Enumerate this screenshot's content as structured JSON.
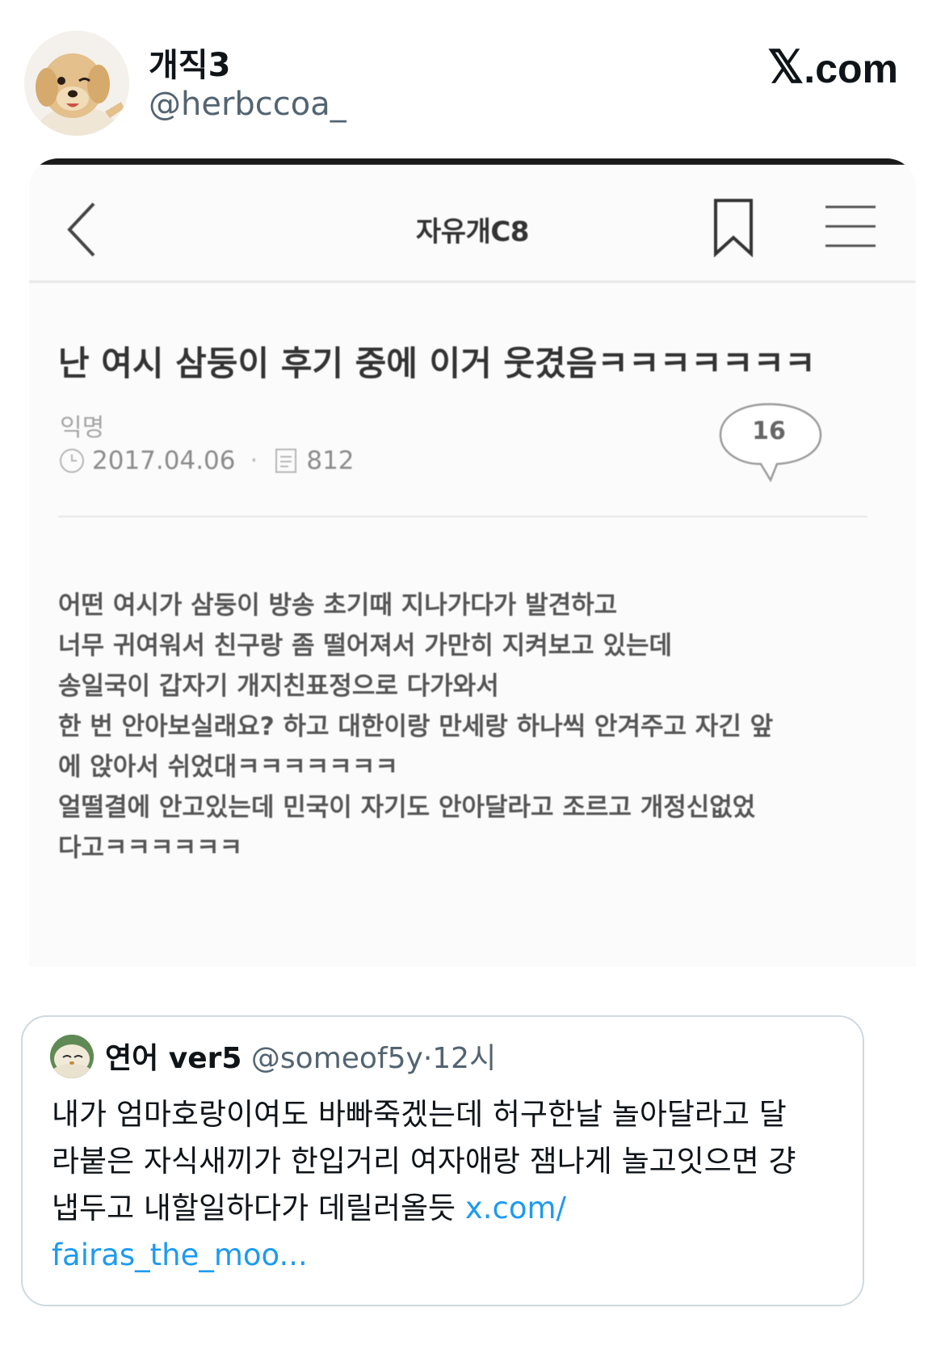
{
  "author": {
    "display_name": "개직3",
    "handle": "@herbccoa_"
  },
  "watermark": {
    "logo": "𝕏",
    "suffix": ".com"
  },
  "screenshot": {
    "board_title": "자유개C8",
    "post_title": "난 여시 삼둥이 후기 중에 이거 웃겼음ㅋㅋㅋㅋㅋㅋㅋ",
    "author": "익명",
    "date": "2017.04.06",
    "views": "812",
    "comment_count": "16",
    "body_lines": [
      "어떤 여시가 삼둥이 방송 초기때 지나가다가 발견하고",
      "너무 귀여워서 친구랑 좀 떨어져서 가만히 지켜보고 있는데",
      "송일국이 갑자기 개지친표정으로 다가와서",
      "한 번 안아보실래요? 하고 대한이랑 만세랑 하나씩 안겨주고 자긴 앞",
      "에 앉아서 쉬었대ㅋㅋㅋㅋㅋㅋㅋ",
      "얼떨결에 안고있는데 민국이 자기도 안아달라고 조르고 개정신없었",
      "다고ㅋㅋㅋㅋㅋㅋ"
    ]
  },
  "quote": {
    "display_name": "연어 ver5",
    "handle": "@someof5y",
    "separator": "·",
    "time": "12시",
    "lines": [
      "내가 엄마호랑이여도 바빠죽겠는데 허구한날 놀아달라고 달",
      "라붙은 자식새끼가 한입거리 여자애랑 잼나게 놀고잇으면 걍",
      "냅두고 내할일하다가 데릴러올듯"
    ],
    "link_part1": "x.com/",
    "link_part2": "fairas_the_moo..."
  },
  "icons": {
    "back": "chevron-left-icon",
    "bookmark": "bookmark-icon",
    "menu": "hamburger-menu-icon",
    "clock": "clock-icon",
    "views": "document-icon",
    "comments": "speech-bubble-icon"
  },
  "colors": {
    "link": "#1d9bf0",
    "secondary_text": "#536471",
    "border": "#cfd9de"
  }
}
